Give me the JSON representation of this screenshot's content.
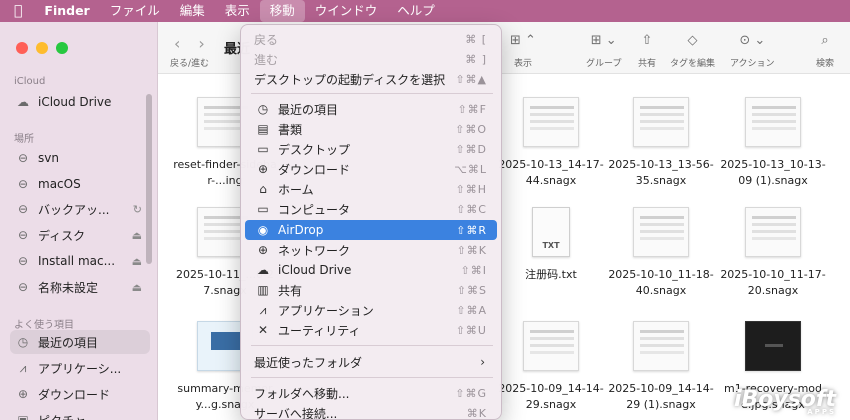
{
  "menubar": {
    "apple": "",
    "items": [
      "Finder",
      "ファイル",
      "編集",
      "表示",
      "移動",
      "ウインドウ",
      "ヘルプ"
    ]
  },
  "sidebar": {
    "sections": [
      "iCloud",
      "場所",
      "よく使う項目"
    ],
    "icloud": [
      {
        "icon": "cloud-icon",
        "label": "iCloud Drive"
      }
    ],
    "locations": [
      {
        "icon": "drive-icon",
        "label": "svn",
        "trail": ""
      },
      {
        "icon": "drive-icon",
        "label": "macOS",
        "trail": ""
      },
      {
        "icon": "drive-icon",
        "label": "バックアッ...",
        "trail": "↻"
      },
      {
        "icon": "drive-icon",
        "label": "ディスク",
        "trail": "⏏"
      },
      {
        "icon": "drive-icon",
        "label": "Install mac...",
        "trail": "⏏"
      },
      {
        "icon": "drive-icon",
        "label": "名称未設定",
        "trail": "⏏"
      }
    ],
    "favorites": [
      {
        "icon": "clock-icon",
        "label": "最近の項目",
        "selected": true
      },
      {
        "icon": "apps-icon",
        "label": "アプリケーシ..."
      },
      {
        "icon": "download-icon",
        "label": "ダウンロード"
      },
      {
        "icon": "picture-icon",
        "label": "ピクチャ"
      }
    ]
  },
  "toolbar": {
    "back": "‹",
    "forward": "›",
    "title": "最近",
    "nav_label": "戻る/進む",
    "buttons": [
      {
        "icon": "view-icon",
        "glyph": "⊞ ⌃",
        "label": "表示"
      },
      {
        "icon": "group-icon",
        "glyph": "⊞ ⌄",
        "label": "グループ"
      },
      {
        "icon": "share-icon",
        "glyph": "⇧",
        "label": "共有"
      },
      {
        "icon": "tag-icon",
        "glyph": "◇",
        "label": "タグを編集"
      },
      {
        "icon": "action-icon",
        "glyph": "⊙ ⌄",
        "label": "アクション"
      },
      {
        "icon": "search-icon",
        "glyph": "⌕",
        "label": "検索"
      }
    ]
  },
  "files": [
    {
      "name": "reset-finder-sidebar-...ing",
      "kind": "doc"
    },
    {
      "name": "2025-10-13_14-17-44.snagx",
      "kind": "doc"
    },
    {
      "name": "2025-10-13_13-56-35.snagx",
      "kind": "doc"
    },
    {
      "name": "2025-10-13_10-13-09 (1).snagx",
      "kind": "doc"
    },
    {
      "name": "2025-10-11_...0-27.snagx",
      "kind": "doc"
    },
    {
      "name": "注册码.txt",
      "kind": "txt"
    },
    {
      "name": "2025-10-10_11-18-40.snagx",
      "kind": "doc"
    },
    {
      "name": "2025-10-10_11-17-20.snagx",
      "kind": "doc"
    },
    {
      "name": "summary-memory...g.snagx",
      "kind": "screen"
    },
    {
      "name": "2025-10-09_14-14-29.snagx",
      "kind": "doc"
    },
    {
      "name": "2025-10-09_14-14-29 (1).snagx",
      "kind": "doc"
    },
    {
      "name": "m1-recovery-mode.jpg.snagx",
      "kind": "dark"
    }
  ],
  "txt_badge": "TXT",
  "menu": {
    "items": [
      {
        "label": "戻る",
        "shortcut": "⌘ [",
        "icon": "",
        "disabled": true
      },
      {
        "label": "進む",
        "shortcut": "⌘ ]",
        "icon": "",
        "disabled": true
      },
      {
        "label": "デスクトップの起動ディスクを選択",
        "shortcut": "⇧⌘▲",
        "icon": ""
      },
      {
        "label": "最近の項目",
        "shortcut": "⇧⌘F",
        "icon": "clock-icon"
      },
      {
        "label": "書類",
        "shortcut": "⇧⌘O",
        "icon": "document-icon"
      },
      {
        "label": "デスクトップ",
        "shortcut": "⇧⌘D",
        "icon": "desktop-icon"
      },
      {
        "label": "ダウンロード",
        "shortcut": "⌥⌘L",
        "icon": "download-icon"
      },
      {
        "label": "ホーム",
        "shortcut": "⇧⌘H",
        "icon": "home-icon"
      },
      {
        "label": "コンピュータ",
        "shortcut": "⇧⌘C",
        "icon": "computer-icon"
      },
      {
        "label": "AirDrop",
        "shortcut": "⇧⌘R",
        "icon": "airdrop-icon",
        "highlighted": true
      },
      {
        "label": "ネットワーク",
        "shortcut": "⇧⌘K",
        "icon": "network-icon"
      },
      {
        "label": "iCloud Drive",
        "shortcut": "⇧⌘I",
        "icon": "cloud-icon"
      },
      {
        "label": "共有",
        "shortcut": "⇧⌘S",
        "icon": "shared-folder-icon"
      },
      {
        "label": "アプリケーション",
        "shortcut": "⇧⌘A",
        "icon": "apps-icon"
      },
      {
        "label": "ユーティリティ",
        "shortcut": "⇧⌘U",
        "icon": "utilities-icon"
      },
      {
        "label": "最近使ったフォルダ",
        "shortcut": "",
        "icon": "",
        "submenu": true
      },
      {
        "label": "フォルダへ移動...",
        "shortcut": "⇧⌘G",
        "icon": ""
      },
      {
        "label": "サーバへ接続...",
        "shortcut": "⌘K",
        "icon": ""
      }
    ]
  },
  "watermark": {
    "brand": "iBoysoft",
    "sub": "APPS"
  },
  "colors": {
    "highlight": "#3b82e0",
    "menubar": "#b4628f"
  }
}
